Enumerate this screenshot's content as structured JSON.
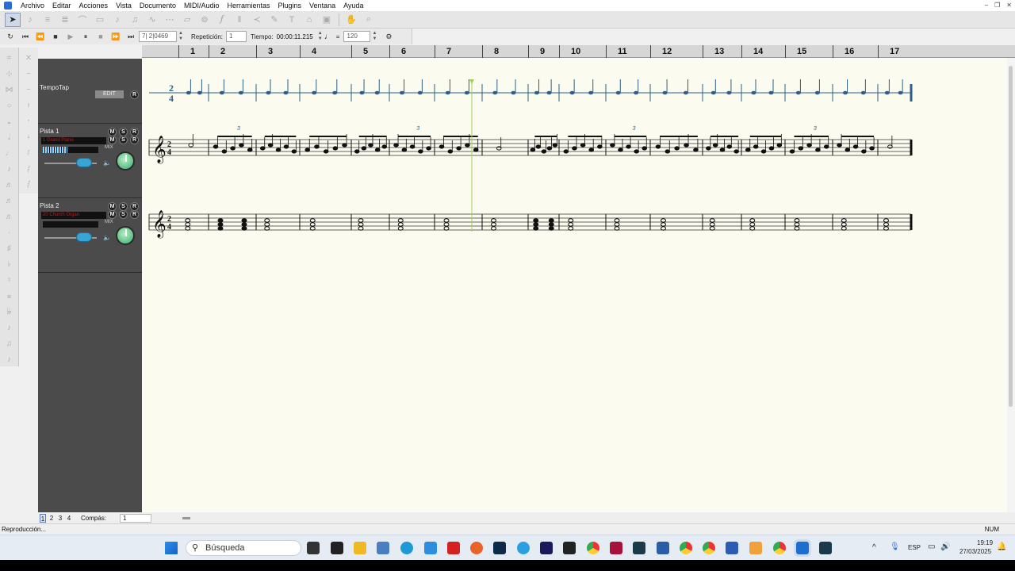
{
  "menu": [
    "Archivo",
    "Editar",
    "Acciones",
    "Vista",
    "Documento",
    "MIDI/Audio",
    "Herramientas",
    "Plugins",
    "Ventana",
    "Ayuda"
  ],
  "transport": {
    "position": "7| 2|0469",
    "repeat_label": "Repetición:",
    "repeat_value": "1",
    "time_label": "Tiempo:",
    "time_value": "00:00:11.215",
    "equals": "=",
    "tempo_value": "120"
  },
  "tracks": [
    {
      "name": "TempoTap",
      "edit_label": "EDIT",
      "buttons": [
        "R"
      ]
    },
    {
      "name": "Pista 1",
      "instrument": "1 Grand Piano",
      "buttons": [
        "M",
        "S",
        "R"
      ],
      "mix_label": "MIX",
      "meter_level": 0.44
    },
    {
      "name": "Pista 2",
      "instrument": "20 Church Organ",
      "buttons": [
        "M",
        "S",
        "R"
      ],
      "mix_label": "MIX",
      "meter_level": 0.0
    }
  ],
  "ruler": {
    "measures": [
      "1",
      "2",
      "3",
      "4",
      "5",
      "6",
      "7",
      "8",
      "9",
      "10",
      "11",
      "12",
      "13",
      "14",
      "15",
      "16",
      "17"
    ]
  },
  "score": {
    "time_signature": [
      "2",
      "4"
    ],
    "triplet_label": "3",
    "playhead_color": "#9ad45a",
    "tempo_staff_color": "#2e5f8a"
  },
  "bottom": {
    "pages": [
      "1",
      "2",
      "3",
      "4"
    ],
    "measure_label": "Compás:",
    "measure_value": "1"
  },
  "status": {
    "text": "Reproducción...",
    "num": "NUM"
  },
  "taskbar": {
    "search_placeholder": "Búsqueda",
    "lang": "ESP",
    "time": "19:19",
    "date": "27/03/2025"
  }
}
